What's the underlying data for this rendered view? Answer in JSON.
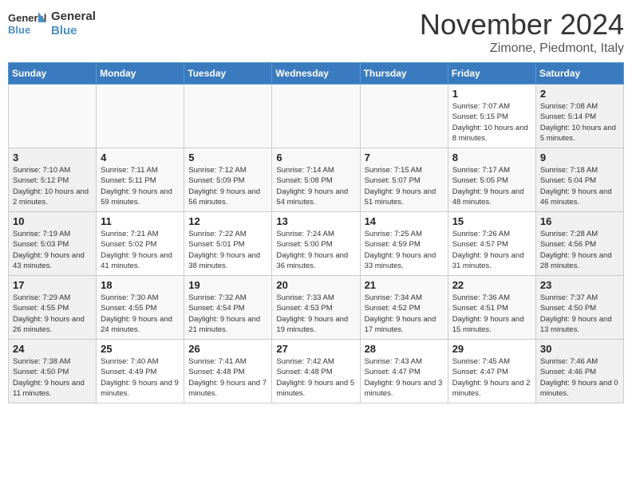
{
  "logo": {
    "line1": "General",
    "line2": "Blue"
  },
  "title": "November 2024",
  "location": "Zimone, Piedmont, Italy",
  "days_of_week": [
    "Sunday",
    "Monday",
    "Tuesday",
    "Wednesday",
    "Thursday",
    "Friday",
    "Saturday"
  ],
  "weeks": [
    [
      {
        "day": "",
        "info": ""
      },
      {
        "day": "",
        "info": ""
      },
      {
        "day": "",
        "info": ""
      },
      {
        "day": "",
        "info": ""
      },
      {
        "day": "",
        "info": ""
      },
      {
        "day": "1",
        "info": "Sunrise: 7:07 AM\nSunset: 5:15 PM\nDaylight: 10 hours and 8 minutes."
      },
      {
        "day": "2",
        "info": "Sunrise: 7:08 AM\nSunset: 5:14 PM\nDaylight: 10 hours and 5 minutes."
      }
    ],
    [
      {
        "day": "3",
        "info": "Sunrise: 7:10 AM\nSunset: 5:12 PM\nDaylight: 10 hours and 2 minutes."
      },
      {
        "day": "4",
        "info": "Sunrise: 7:11 AM\nSunset: 5:11 PM\nDaylight: 9 hours and 59 minutes."
      },
      {
        "day": "5",
        "info": "Sunrise: 7:12 AM\nSunset: 5:09 PM\nDaylight: 9 hours and 56 minutes."
      },
      {
        "day": "6",
        "info": "Sunrise: 7:14 AM\nSunset: 5:08 PM\nDaylight: 9 hours and 54 minutes."
      },
      {
        "day": "7",
        "info": "Sunrise: 7:15 AM\nSunset: 5:07 PM\nDaylight: 9 hours and 51 minutes."
      },
      {
        "day": "8",
        "info": "Sunrise: 7:17 AM\nSunset: 5:05 PM\nDaylight: 9 hours and 48 minutes."
      },
      {
        "day": "9",
        "info": "Sunrise: 7:18 AM\nSunset: 5:04 PM\nDaylight: 9 hours and 46 minutes."
      }
    ],
    [
      {
        "day": "10",
        "info": "Sunrise: 7:19 AM\nSunset: 5:03 PM\nDaylight: 9 hours and 43 minutes."
      },
      {
        "day": "11",
        "info": "Sunrise: 7:21 AM\nSunset: 5:02 PM\nDaylight: 9 hours and 41 minutes."
      },
      {
        "day": "12",
        "info": "Sunrise: 7:22 AM\nSunset: 5:01 PM\nDaylight: 9 hours and 38 minutes."
      },
      {
        "day": "13",
        "info": "Sunrise: 7:24 AM\nSunset: 5:00 PM\nDaylight: 9 hours and 36 minutes."
      },
      {
        "day": "14",
        "info": "Sunrise: 7:25 AM\nSunset: 4:59 PM\nDaylight: 9 hours and 33 minutes."
      },
      {
        "day": "15",
        "info": "Sunrise: 7:26 AM\nSunset: 4:57 PM\nDaylight: 9 hours and 31 minutes."
      },
      {
        "day": "16",
        "info": "Sunrise: 7:28 AM\nSunset: 4:56 PM\nDaylight: 9 hours and 28 minutes."
      }
    ],
    [
      {
        "day": "17",
        "info": "Sunrise: 7:29 AM\nSunset: 4:55 PM\nDaylight: 9 hours and 26 minutes."
      },
      {
        "day": "18",
        "info": "Sunrise: 7:30 AM\nSunset: 4:55 PM\nDaylight: 9 hours and 24 minutes."
      },
      {
        "day": "19",
        "info": "Sunrise: 7:32 AM\nSunset: 4:54 PM\nDaylight: 9 hours and 21 minutes."
      },
      {
        "day": "20",
        "info": "Sunrise: 7:33 AM\nSunset: 4:53 PM\nDaylight: 9 hours and 19 minutes."
      },
      {
        "day": "21",
        "info": "Sunrise: 7:34 AM\nSunset: 4:52 PM\nDaylight: 9 hours and 17 minutes."
      },
      {
        "day": "22",
        "info": "Sunrise: 7:36 AM\nSunset: 4:51 PM\nDaylight: 9 hours and 15 minutes."
      },
      {
        "day": "23",
        "info": "Sunrise: 7:37 AM\nSunset: 4:50 PM\nDaylight: 9 hours and 13 minutes."
      }
    ],
    [
      {
        "day": "24",
        "info": "Sunrise: 7:38 AM\nSunset: 4:50 PM\nDaylight: 9 hours and 11 minutes."
      },
      {
        "day": "25",
        "info": "Sunrise: 7:40 AM\nSunset: 4:49 PM\nDaylight: 9 hours and 9 minutes."
      },
      {
        "day": "26",
        "info": "Sunrise: 7:41 AM\nSunset: 4:48 PM\nDaylight: 9 hours and 7 minutes."
      },
      {
        "day": "27",
        "info": "Sunrise: 7:42 AM\nSunset: 4:48 PM\nDaylight: 9 hours and 5 minutes."
      },
      {
        "day": "28",
        "info": "Sunrise: 7:43 AM\nSunset: 4:47 PM\nDaylight: 9 hours and 3 minutes."
      },
      {
        "day": "29",
        "info": "Sunrise: 7:45 AM\nSunset: 4:47 PM\nDaylight: 9 hours and 2 minutes."
      },
      {
        "day": "30",
        "info": "Sunrise: 7:46 AM\nSunset: 4:46 PM\nDaylight: 9 hours and 0 minutes."
      }
    ]
  ]
}
